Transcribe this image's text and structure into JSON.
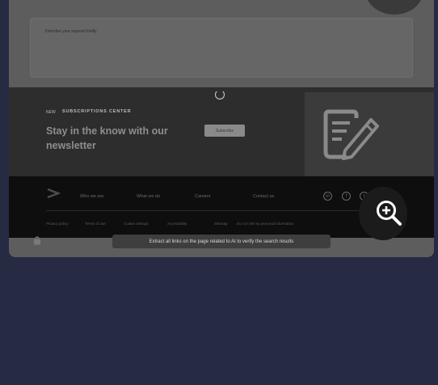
{
  "form": {
    "label": "Describe your request briefly"
  },
  "newsletter": {
    "tag": "NEW",
    "eyebrow": "SUBSCRIPTIONS CENTER",
    "headline": "Stay in the know with our newsletter",
    "subscribe_label": "Subscribe"
  },
  "footer": {
    "nav": [
      "Who we are",
      "What we do",
      "Careers",
      "Contact us"
    ],
    "social": [
      "in",
      "f",
      "t"
    ],
    "legal": [
      "Privacy policy",
      "Terms of use",
      "Cookie settings",
      "Accessibility",
      "Sitemap",
      "Do not sell my personal information"
    ]
  },
  "tooltip": {
    "text": "Extract all links on the page related to AI to verify the search results"
  },
  "icons": {
    "spinner": "loading-spinner-icon",
    "edit": "edit-document-icon",
    "zoom": "zoom-in-icon",
    "logo": "chevron-logo-icon"
  }
}
